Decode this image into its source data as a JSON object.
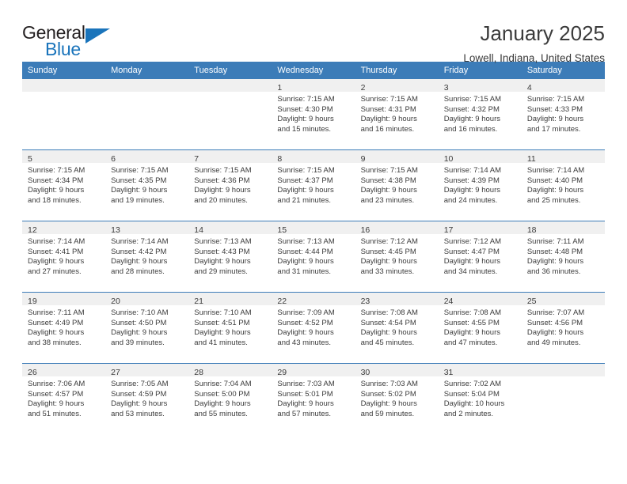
{
  "brand": {
    "name_part1": "General",
    "name_part2": "Blue",
    "triangle_color": "#1a74bb"
  },
  "header": {
    "title": "January 2025",
    "subtitle": "Lowell, Indiana, United States"
  },
  "theme": {
    "header_blue": "#3c7cb8",
    "daynum_band": "#f0f0f0",
    "text": "#3b3b3b"
  },
  "weekday_headers": [
    "Sunday",
    "Monday",
    "Tuesday",
    "Wednesday",
    "Thursday",
    "Friday",
    "Saturday"
  ],
  "labels": {
    "sunrise_prefix": "Sunrise:",
    "sunset_prefix": "Sunset:",
    "daylight_prefix": "Daylight:"
  },
  "weeks": [
    [
      {
        "day": "",
        "line1": "",
        "line2": "",
        "line3": "",
        "line4": ""
      },
      {
        "day": "",
        "line1": "",
        "line2": "",
        "line3": "",
        "line4": ""
      },
      {
        "day": "",
        "line1": "",
        "line2": "",
        "line3": "",
        "line4": ""
      },
      {
        "day": "1",
        "line1": "Sunrise: 7:15 AM",
        "line2": "Sunset: 4:30 PM",
        "line3": "Daylight: 9 hours",
        "line4": "and 15 minutes."
      },
      {
        "day": "2",
        "line1": "Sunrise: 7:15 AM",
        "line2": "Sunset: 4:31 PM",
        "line3": "Daylight: 9 hours",
        "line4": "and 16 minutes."
      },
      {
        "day": "3",
        "line1": "Sunrise: 7:15 AM",
        "line2": "Sunset: 4:32 PM",
        "line3": "Daylight: 9 hours",
        "line4": "and 16 minutes."
      },
      {
        "day": "4",
        "line1": "Sunrise: 7:15 AM",
        "line2": "Sunset: 4:33 PM",
        "line3": "Daylight: 9 hours",
        "line4": "and 17 minutes."
      }
    ],
    [
      {
        "day": "5",
        "line1": "Sunrise: 7:15 AM",
        "line2": "Sunset: 4:34 PM",
        "line3": "Daylight: 9 hours",
        "line4": "and 18 minutes."
      },
      {
        "day": "6",
        "line1": "Sunrise: 7:15 AM",
        "line2": "Sunset: 4:35 PM",
        "line3": "Daylight: 9 hours",
        "line4": "and 19 minutes."
      },
      {
        "day": "7",
        "line1": "Sunrise: 7:15 AM",
        "line2": "Sunset: 4:36 PM",
        "line3": "Daylight: 9 hours",
        "line4": "and 20 minutes."
      },
      {
        "day": "8",
        "line1": "Sunrise: 7:15 AM",
        "line2": "Sunset: 4:37 PM",
        "line3": "Daylight: 9 hours",
        "line4": "and 21 minutes."
      },
      {
        "day": "9",
        "line1": "Sunrise: 7:15 AM",
        "line2": "Sunset: 4:38 PM",
        "line3": "Daylight: 9 hours",
        "line4": "and 23 minutes."
      },
      {
        "day": "10",
        "line1": "Sunrise: 7:14 AM",
        "line2": "Sunset: 4:39 PM",
        "line3": "Daylight: 9 hours",
        "line4": "and 24 minutes."
      },
      {
        "day": "11",
        "line1": "Sunrise: 7:14 AM",
        "line2": "Sunset: 4:40 PM",
        "line3": "Daylight: 9 hours",
        "line4": "and 25 minutes."
      }
    ],
    [
      {
        "day": "12",
        "line1": "Sunrise: 7:14 AM",
        "line2": "Sunset: 4:41 PM",
        "line3": "Daylight: 9 hours",
        "line4": "and 27 minutes."
      },
      {
        "day": "13",
        "line1": "Sunrise: 7:14 AM",
        "line2": "Sunset: 4:42 PM",
        "line3": "Daylight: 9 hours",
        "line4": "and 28 minutes."
      },
      {
        "day": "14",
        "line1": "Sunrise: 7:13 AM",
        "line2": "Sunset: 4:43 PM",
        "line3": "Daylight: 9 hours",
        "line4": "and 29 minutes."
      },
      {
        "day": "15",
        "line1": "Sunrise: 7:13 AM",
        "line2": "Sunset: 4:44 PM",
        "line3": "Daylight: 9 hours",
        "line4": "and 31 minutes."
      },
      {
        "day": "16",
        "line1": "Sunrise: 7:12 AM",
        "line2": "Sunset: 4:45 PM",
        "line3": "Daylight: 9 hours",
        "line4": "and 33 minutes."
      },
      {
        "day": "17",
        "line1": "Sunrise: 7:12 AM",
        "line2": "Sunset: 4:47 PM",
        "line3": "Daylight: 9 hours",
        "line4": "and 34 minutes."
      },
      {
        "day": "18",
        "line1": "Sunrise: 7:11 AM",
        "line2": "Sunset: 4:48 PM",
        "line3": "Daylight: 9 hours",
        "line4": "and 36 minutes."
      }
    ],
    [
      {
        "day": "19",
        "line1": "Sunrise: 7:11 AM",
        "line2": "Sunset: 4:49 PM",
        "line3": "Daylight: 9 hours",
        "line4": "and 38 minutes."
      },
      {
        "day": "20",
        "line1": "Sunrise: 7:10 AM",
        "line2": "Sunset: 4:50 PM",
        "line3": "Daylight: 9 hours",
        "line4": "and 39 minutes."
      },
      {
        "day": "21",
        "line1": "Sunrise: 7:10 AM",
        "line2": "Sunset: 4:51 PM",
        "line3": "Daylight: 9 hours",
        "line4": "and 41 minutes."
      },
      {
        "day": "22",
        "line1": "Sunrise: 7:09 AM",
        "line2": "Sunset: 4:52 PM",
        "line3": "Daylight: 9 hours",
        "line4": "and 43 minutes."
      },
      {
        "day": "23",
        "line1": "Sunrise: 7:08 AM",
        "line2": "Sunset: 4:54 PM",
        "line3": "Daylight: 9 hours",
        "line4": "and 45 minutes."
      },
      {
        "day": "24",
        "line1": "Sunrise: 7:08 AM",
        "line2": "Sunset: 4:55 PM",
        "line3": "Daylight: 9 hours",
        "line4": "and 47 minutes."
      },
      {
        "day": "25",
        "line1": "Sunrise: 7:07 AM",
        "line2": "Sunset: 4:56 PM",
        "line3": "Daylight: 9 hours",
        "line4": "and 49 minutes."
      }
    ],
    [
      {
        "day": "26",
        "line1": "Sunrise: 7:06 AM",
        "line2": "Sunset: 4:57 PM",
        "line3": "Daylight: 9 hours",
        "line4": "and 51 minutes."
      },
      {
        "day": "27",
        "line1": "Sunrise: 7:05 AM",
        "line2": "Sunset: 4:59 PM",
        "line3": "Daylight: 9 hours",
        "line4": "and 53 minutes."
      },
      {
        "day": "28",
        "line1": "Sunrise: 7:04 AM",
        "line2": "Sunset: 5:00 PM",
        "line3": "Daylight: 9 hours",
        "line4": "and 55 minutes."
      },
      {
        "day": "29",
        "line1": "Sunrise: 7:03 AM",
        "line2": "Sunset: 5:01 PM",
        "line3": "Daylight: 9 hours",
        "line4": "and 57 minutes."
      },
      {
        "day": "30",
        "line1": "Sunrise: 7:03 AM",
        "line2": "Sunset: 5:02 PM",
        "line3": "Daylight: 9 hours",
        "line4": "and 59 minutes."
      },
      {
        "day": "31",
        "line1": "Sunrise: 7:02 AM",
        "line2": "Sunset: 5:04 PM",
        "line3": "Daylight: 10 hours",
        "line4": "and 2 minutes."
      },
      {
        "day": "",
        "line1": "",
        "line2": "",
        "line3": "",
        "line4": ""
      }
    ]
  ]
}
